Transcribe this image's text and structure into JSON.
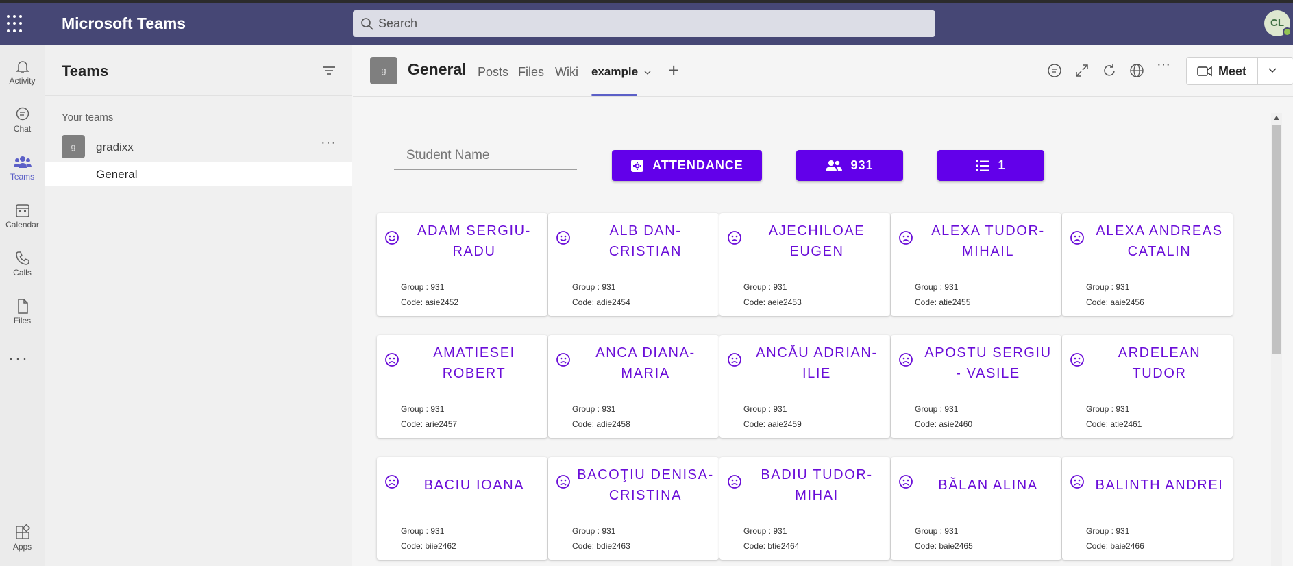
{
  "app": {
    "title": "Microsoft Teams",
    "avatar_initials": "CL"
  },
  "search": {
    "placeholder": "Search"
  },
  "rail": [
    {
      "label": "Activity",
      "icon": "bell-icon"
    },
    {
      "label": "Chat",
      "icon": "chat-icon"
    },
    {
      "label": "Teams",
      "icon": "teams-icon"
    },
    {
      "label": "Calendar",
      "icon": "calendar-icon"
    },
    {
      "label": "Calls",
      "icon": "phone-icon"
    },
    {
      "label": "Files",
      "icon": "file-icon"
    },
    {
      "label": "Apps",
      "icon": "apps-icon"
    }
  ],
  "teams_panel": {
    "title": "Teams",
    "section_label": "Your teams",
    "team": {
      "initial": "g",
      "name": "gradixx"
    },
    "channel": "General"
  },
  "channel_header": {
    "initial": "g",
    "name": "General",
    "tabs": [
      "Posts",
      "Files",
      "Wiki",
      "example"
    ],
    "active_tab": "example",
    "meet_label": "Meet"
  },
  "content": {
    "student_placeholder": "Student Name",
    "attendance_label": "ATTENDANCE",
    "group_label": "931",
    "list_label": "1"
  },
  "colors": {
    "accent": "#6200ea",
    "name_text": "#6a0dd8",
    "teams_bar": "#464775",
    "active_tab": "#5b5fc7"
  },
  "students": [
    {
      "name": "ADAM SERGIU-RADU",
      "group": "Group : 931",
      "code": "Code: asie2452",
      "mood": "smile-icon"
    },
    {
      "name": "ALB DAN-CRISTIAN",
      "group": "Group : 931",
      "code": "Code: adie2454",
      "mood": "smile-icon"
    },
    {
      "name": "AJECHILOAE EUGEN",
      "group": "Group : 931",
      "code": "Code: aeie2453",
      "mood": "frown-icon"
    },
    {
      "name": "ALEXA TUDOR-MIHAIL",
      "group": "Group : 931",
      "code": "Code: atie2455",
      "mood": "frown-icon"
    },
    {
      "name": "ALEXA ANDREAS CATALIN",
      "group": "Group : 931",
      "code": "Code: aaie2456",
      "mood": "frown-icon"
    },
    {
      "name": "AMATIESEI ROBERT",
      "group": "Group : 931",
      "code": "Code: arie2457",
      "mood": "frown-icon"
    },
    {
      "name": "ANCA DIANA-MARIA",
      "group": "Group : 931",
      "code": "Code: adie2458",
      "mood": "frown-icon"
    },
    {
      "name": "ANCĂU ADRIAN-ILIE",
      "group": "Group : 931",
      "code": "Code: aaie2459",
      "mood": "frown-icon"
    },
    {
      "name": "APOSTU SERGIU - VASILE",
      "group": "Group : 931",
      "code": "Code: asie2460",
      "mood": "frown-icon"
    },
    {
      "name": "ARDELEAN TUDOR",
      "group": "Group : 931",
      "code": "Code: atie2461",
      "mood": "frown-icon"
    },
    {
      "name": "BACIU IOANA",
      "group": "Group : 931",
      "code": "Code: biie2462",
      "mood": "frown-icon"
    },
    {
      "name": "BACOŢIU DENISA-CRISTINA",
      "group": "Group : 931",
      "code": "Code: bdie2463",
      "mood": "frown-icon"
    },
    {
      "name": "BADIU TUDOR-MIHAI",
      "group": "Group : 931",
      "code": "Code: btie2464",
      "mood": "frown-icon"
    },
    {
      "name": "BĂLAN ALINA",
      "group": "Group : 931",
      "code": "Code: baie2465",
      "mood": "frown-icon"
    },
    {
      "name": "BALINTH ANDREI",
      "group": "Group : 931",
      "code": "Code: baie2466",
      "mood": "frown-icon"
    }
  ]
}
